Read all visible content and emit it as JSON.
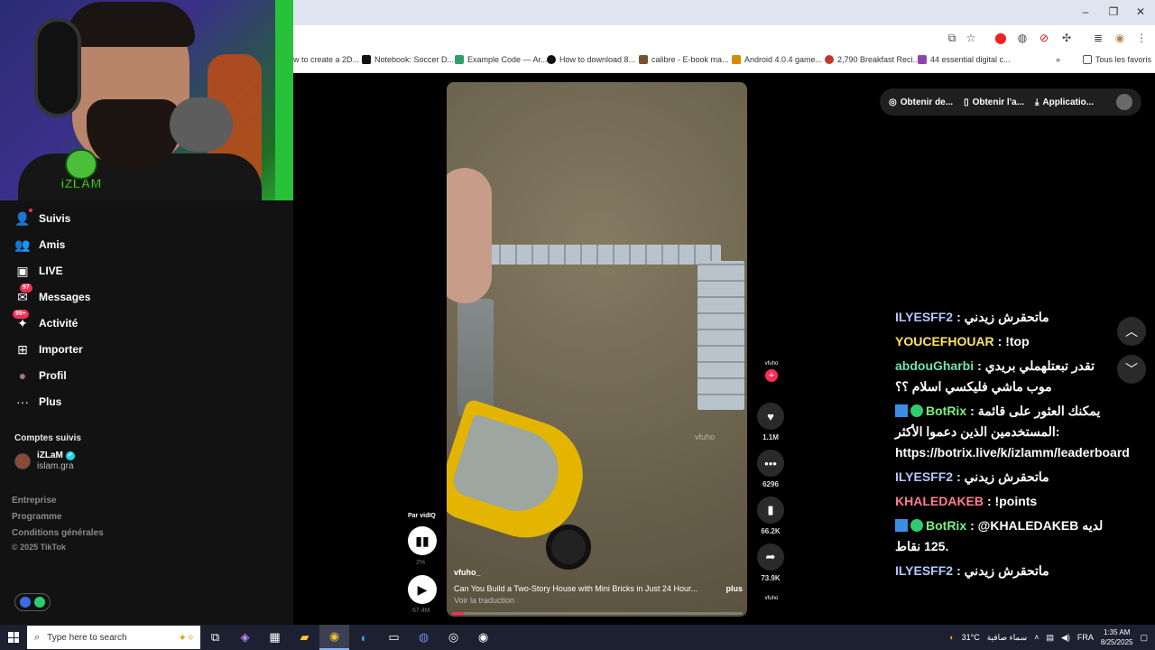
{
  "browser": {
    "bookmarks": [
      {
        "label": "w to create a 2D...",
        "color": "#5b9bd5"
      },
      {
        "label": "Notebook: Soccer D...",
        "color": "#111111"
      },
      {
        "label": "Example Code — Ar...",
        "color": "#2e9e6a"
      },
      {
        "label": "How to download 8...",
        "color": "#111111"
      },
      {
        "label": "calibre - E-book ma...",
        "color": "#7a5230"
      },
      {
        "label": "Android 4.0.4 game...",
        "color": "#d88b00"
      },
      {
        "label": "2,790 Breakfast Reci...",
        "color": "#c0392b"
      },
      {
        "label": "44 essential digital c...",
        "color": "#8e44ad"
      }
    ],
    "all_bookmarks": "Tous les favoris"
  },
  "stream": {
    "logo_text": "iZLAM"
  },
  "sidebar": {
    "nav": [
      {
        "id": "suivis",
        "label": "Suivis",
        "icon": "following-icon",
        "glyph": "👤",
        "badge": ""
      },
      {
        "id": "amis",
        "label": "Amis",
        "icon": "friends-icon",
        "glyph": "👥",
        "badge": ""
      },
      {
        "id": "live",
        "label": "LIVE",
        "icon": "live-icon",
        "glyph": "▣",
        "badge": ""
      },
      {
        "id": "messages",
        "label": "Messages",
        "icon": "messages-icon",
        "glyph": "✉",
        "badge": "97"
      },
      {
        "id": "activite",
        "label": "Activité",
        "icon": "activity-icon",
        "glyph": "✦",
        "badge": "99+"
      },
      {
        "id": "importer",
        "label": "Importer",
        "icon": "upload-icon",
        "glyph": "⊞",
        "badge": ""
      },
      {
        "id": "profil",
        "label": "Profil",
        "icon": "profile-icon",
        "glyph": "●",
        "badge": ""
      },
      {
        "id": "plus",
        "label": "Plus",
        "icon": "more-icon",
        "glyph": "···",
        "badge": ""
      }
    ],
    "followed_title": "Comptes suivis",
    "account": {
      "name": "iZLaM",
      "handle": "islam.gra"
    },
    "footer": [
      "Entreprise",
      "Programme",
      "Conditions générales"
    ],
    "copyright": "© 2025 TikTok"
  },
  "video": {
    "username": "vfuho_",
    "caption": "Can You Build a Two-Story House with Mini Bricks in Just 24 Hour...",
    "more": "plus",
    "translate": "Voir la traduction",
    "watermark": "vfuho",
    "progress": 0.04
  },
  "controls": {
    "vidiq_label": "Par vidIQ",
    "vidiq_pct": "2%",
    "play_count": "67.4M"
  },
  "actions": {
    "creator": "vfuho",
    "likes": "1.1M",
    "comments": "6296",
    "saves": "66.2K",
    "shares": "73.9K",
    "music": "vfuho"
  },
  "top_actions": [
    {
      "label": "Obtenir de...",
      "icon": "coin-icon",
      "glyph": "◎"
    },
    {
      "label": "Obtenir l'a...",
      "icon": "phone-icon",
      "glyph": "▯"
    },
    {
      "label": "Applicatio...",
      "icon": "download-icon",
      "glyph": "⤓"
    }
  ],
  "chat": [
    {
      "user": "ILYESFF2",
      "color": "#b4c6ff",
      "text": ": ماتحقرش زيدني",
      "mod": false
    },
    {
      "user": "YOUCEFHOUAR",
      "color": "#ffe45c",
      "text": ": !top",
      "mod": false
    },
    {
      "user": "abdouGharbi",
      "color": "#6fe3b0",
      "text": ": تقدر تبعتلهملي بريدي موب ماشي فليكسي اسلام ؟؟",
      "mod": false
    },
    {
      "user": "BotRix",
      "color": "#7cf07c",
      "text": ": يمكنك العثور على قائمة المستخدمين الذين دعموا الأكثر: https://botrix.live/k/izlamm/leaderboard",
      "mod": true
    },
    {
      "user": "ILYESFF2",
      "color": "#b4c6ff",
      "text": ": ماتحقرش زيدني",
      "mod": false
    },
    {
      "user": "KHALEDAKEB",
      "color": "#ff7b92",
      "text": ": !points",
      "mod": false
    },
    {
      "user": "BotRix",
      "color": "#7cf07c",
      "text": ": @KHALEDAKEB لديه 125 نقاط.",
      "mod": true
    },
    {
      "user": "ILYESFF2",
      "color": "#b4c6ff",
      "text": ": ماتحقرش زيدني",
      "mod": false
    }
  ],
  "taskbar": {
    "search_placeholder": "Type here to search",
    "temp": "31°C",
    "weather": "سماء صافية",
    "lang": "FRA",
    "time": "1:35 AM",
    "date": "8/25/2025"
  }
}
